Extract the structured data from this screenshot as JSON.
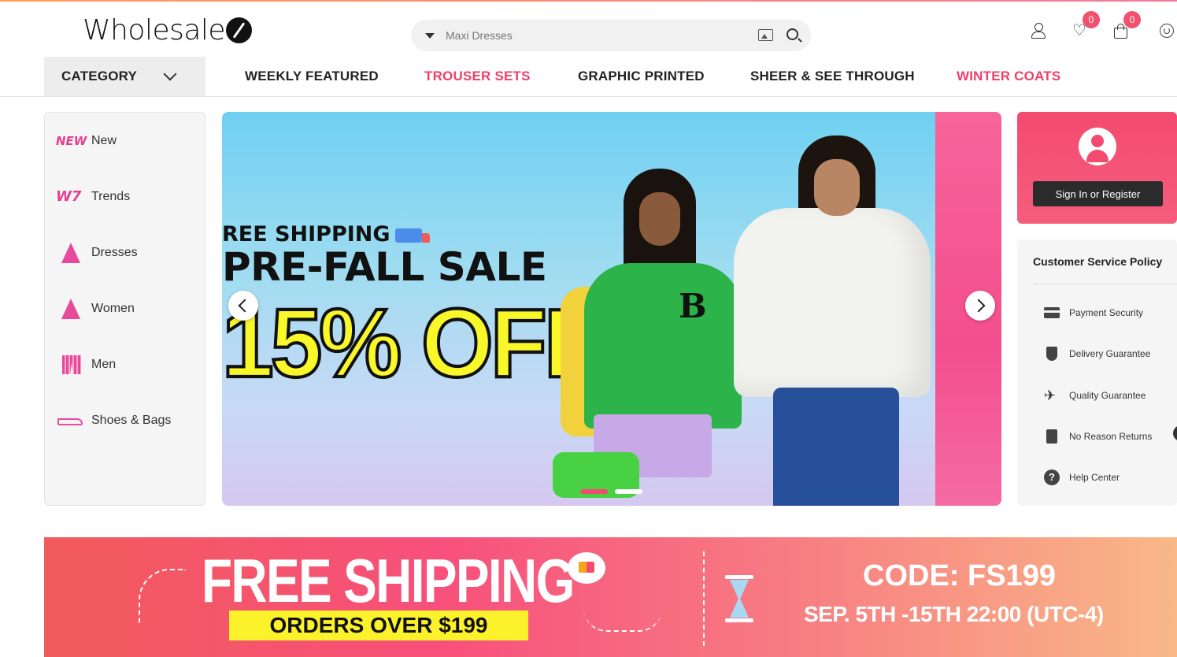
{
  "header": {
    "logo_text": "Wholesale",
    "search": {
      "placeholder": "Maxi Dresses"
    },
    "wishlist_count": "0",
    "cart_count": "0"
  },
  "nav": {
    "category_label": "CATEGORY",
    "links": [
      {
        "label": "WEEKLY FEATURED",
        "color": "#222222"
      },
      {
        "label": "TROUSER SETS",
        "color": "#f03e6a"
      },
      {
        "label": "GRAPHIC PRINTED",
        "color": "#222222"
      },
      {
        "label": "SHEER & SEE THROUGH",
        "color": "#222222"
      },
      {
        "label": "WINTER COATS",
        "color": "#f03e6a"
      }
    ]
  },
  "sidebar": {
    "items": [
      {
        "label": "New",
        "icon": "new-icon"
      },
      {
        "label": "Trends",
        "icon": "trends-icon"
      },
      {
        "label": "Dresses",
        "icon": "dress-icon"
      },
      {
        "label": "Women",
        "icon": "women-dress-icon"
      },
      {
        "label": "Men",
        "icon": "shorts-icon"
      },
      {
        "label": "Shoes & Bags",
        "icon": "shoe-icon"
      }
    ]
  },
  "carousel": {
    "line1": "REE SHIPPING",
    "line2": "PRE-FALL SALE",
    "line3": "15% OFF",
    "jacket_letter": "B",
    "slides": 2,
    "active_slide": 1
  },
  "account": {
    "signin_label": "Sign In or Register"
  },
  "policy": {
    "title": "Customer Service Policy",
    "items": [
      {
        "label": "Payment Security",
        "icon": "card-icon"
      },
      {
        "label": "Delivery Guarantee",
        "icon": "shield-icon"
      },
      {
        "label": "Quality Guarantee",
        "icon": "plane-icon"
      },
      {
        "label": "No Reason Returns",
        "icon": "return-icon"
      },
      {
        "label": "Help Center",
        "icon": "help-icon"
      }
    ]
  },
  "promo": {
    "title": "FREE SHIPPING",
    "subtitle": "ORDERS OVER $199",
    "code": "CODE: FS199",
    "date": "SEP. 5TH -15TH  22:00 (UTC-4)"
  },
  "colors": {
    "accent": "#f03e6a",
    "promo_yellow": "#fbf22c",
    "signin_button": "#2b2b2b"
  }
}
